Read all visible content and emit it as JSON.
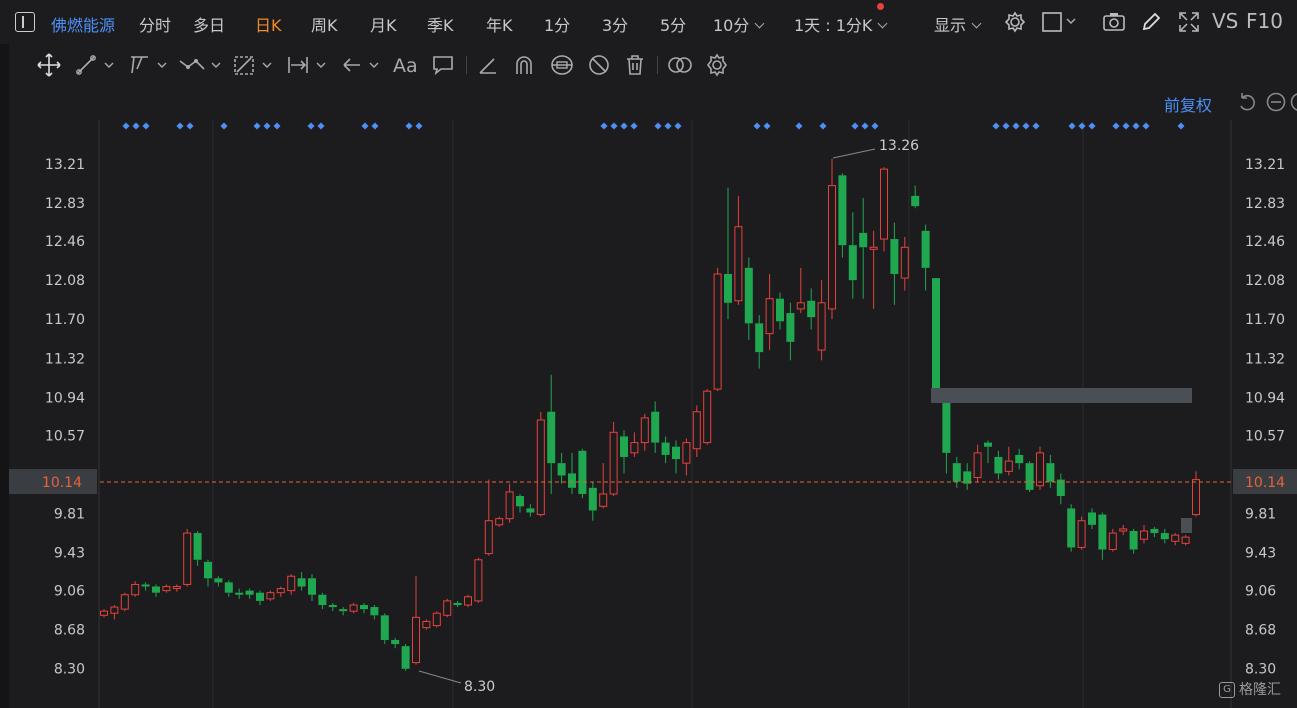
{
  "topbar": {
    "stock_name": "佛燃能源",
    "periods": [
      "分时",
      "多日",
      "日K",
      "周K",
      "月K",
      "季K",
      "年K",
      "1分",
      "3分",
      "5分",
      "10分"
    ],
    "active_period": "日K",
    "range_label": "1天 : 1分K",
    "display_label": "显示",
    "vs_label": "VS",
    "f10_label": "F10"
  },
  "chart": {
    "adjust_label": "前复权",
    "price_labels": [
      "13.21",
      "12.83",
      "12.46",
      "12.08",
      "11.70",
      "11.32",
      "10.94",
      "10.57",
      "10.14",
      "9.81",
      "9.43",
      "9.06",
      "8.68",
      "8.30"
    ],
    "current_price": "10.14",
    "high_marker": "13.26",
    "low_marker": "8.30"
  },
  "colors": {
    "up": "#e8413b",
    "down": "#1fa84f",
    "accent": "#4d8ff5",
    "active": "#f08a2a",
    "dashed_line": "#e8623a"
  },
  "candles": [
    [
      8.82,
      8.86,
      8.8,
      8.88
    ],
    [
      8.84,
      8.9,
      8.78,
      8.92
    ],
    [
      8.88,
      9.02,
      8.86,
      9.04
    ],
    [
      9.02,
      9.12,
      9.0,
      9.15
    ],
    [
      9.12,
      9.1,
      9.06,
      9.14
    ],
    [
      9.1,
      9.04,
      9.0,
      9.12
    ],
    [
      9.06,
      9.1,
      9.04,
      9.12
    ],
    [
      9.08,
      9.1,
      9.05,
      9.12
    ],
    [
      9.12,
      9.62,
      9.1,
      9.66
    ],
    [
      9.62,
      9.36,
      9.3,
      9.64
    ],
    [
      9.34,
      9.18,
      9.1,
      9.36
    ],
    [
      9.18,
      9.14,
      9.1,
      9.2
    ],
    [
      9.14,
      9.04,
      9.0,
      9.16
    ],
    [
      9.04,
      9.02,
      8.98,
      9.08
    ],
    [
      9.06,
      9.02,
      8.98,
      9.08
    ],
    [
      9.04,
      8.96,
      8.92,
      9.06
    ],
    [
      8.98,
      9.04,
      8.96,
      9.06
    ],
    [
      9.04,
      9.08,
      9.0,
      9.1
    ],
    [
      9.06,
      9.2,
      9.02,
      9.22
    ],
    [
      9.18,
      9.1,
      9.06,
      9.24
    ],
    [
      9.18,
      9.02,
      8.96,
      9.22
    ],
    [
      9.02,
      8.92,
      8.88,
      9.04
    ],
    [
      8.92,
      8.9,
      8.86,
      8.94
    ],
    [
      8.88,
      8.86,
      8.82,
      8.9
    ],
    [
      8.86,
      8.92,
      8.84,
      8.94
    ],
    [
      8.92,
      8.88,
      8.84,
      8.94
    ],
    [
      8.9,
      8.82,
      8.78,
      8.92
    ],
    [
      8.82,
      8.58,
      8.54,
      8.84
    ],
    [
      8.58,
      8.54,
      8.5,
      8.6
    ],
    [
      8.52,
      8.3,
      8.28,
      8.54
    ],
    [
      8.36,
      8.8,
      8.34,
      9.2
    ],
    [
      8.7,
      8.76,
      8.68,
      8.78
    ],
    [
      8.72,
      8.84,
      8.7,
      8.86
    ],
    [
      8.82,
      8.96,
      8.8,
      8.98
    ],
    [
      8.94,
      8.92,
      8.9,
      8.96
    ],
    [
      8.92,
      9.0,
      8.9,
      9.02
    ],
    [
      8.96,
      9.36,
      8.94,
      9.38
    ],
    [
      9.42,
      9.74,
      9.4,
      10.14
    ],
    [
      9.7,
      9.76,
      9.68,
      9.78
    ],
    [
      9.76,
      10.02,
      9.72,
      10.1
    ],
    [
      9.98,
      9.88,
      9.82,
      10.0
    ],
    [
      9.86,
      9.82,
      9.78,
      9.9
    ],
    [
      9.8,
      10.72,
      9.78,
      10.8
    ],
    [
      10.8,
      10.3,
      10.0,
      11.16
    ],
    [
      10.3,
      10.18,
      10.1,
      10.4
    ],
    [
      10.2,
      10.06,
      10.0,
      10.4
    ],
    [
      10.42,
      10.0,
      9.96,
      10.44
    ],
    [
      10.06,
      9.84,
      9.74,
      10.12
    ],
    [
      9.88,
      10.0,
      9.86,
      10.3
    ],
    [
      10.0,
      10.6,
      9.98,
      10.7
    ],
    [
      10.56,
      10.36,
      10.2,
      10.62
    ],
    [
      10.4,
      10.5,
      10.36,
      10.6
    ],
    [
      10.5,
      10.74,
      10.42,
      10.78
    ],
    [
      10.8,
      10.5,
      10.4,
      10.9
    ],
    [
      10.5,
      10.38,
      10.3,
      10.56
    ],
    [
      10.46,
      10.34,
      10.2,
      10.52
    ],
    [
      10.3,
      10.5,
      10.18,
      10.54
    ],
    [
      10.44,
      10.8,
      10.36,
      10.86
    ],
    [
      10.5,
      11.0,
      10.48,
      11.02
    ],
    [
      11.02,
      12.14,
      11.0,
      12.2
    ],
    [
      12.14,
      11.86,
      11.7,
      12.98
    ],
    [
      11.88,
      12.6,
      11.84,
      12.9
    ],
    [
      12.2,
      11.66,
      11.5,
      12.3
    ],
    [
      11.66,
      11.38,
      11.22,
      11.74
    ],
    [
      11.56,
      11.9,
      11.4,
      12.14
    ],
    [
      11.9,
      11.68,
      11.6,
      11.96
    ],
    [
      11.76,
      11.48,
      11.3,
      11.86
    ],
    [
      11.8,
      11.86,
      11.76,
      12.2
    ],
    [
      11.88,
      11.72,
      11.6,
      12.0
    ],
    [
      11.4,
      11.86,
      11.3,
      12.08
    ],
    [
      11.8,
      13.0,
      11.7,
      13.26
    ],
    [
      13.1,
      12.42,
      12.3,
      13.12
    ],
    [
      12.42,
      12.08,
      11.9,
      12.74
    ],
    [
      12.54,
      12.4,
      11.9,
      12.88
    ],
    [
      12.38,
      12.4,
      11.8,
      12.56
    ],
    [
      12.48,
      13.16,
      12.36,
      13.18
    ],
    [
      12.48,
      12.14,
      11.84,
      12.64
    ],
    [
      12.1,
      12.4,
      11.98,
      12.5
    ],
    [
      12.9,
      12.8,
      12.78,
      13.0
    ],
    [
      12.56,
      12.2,
      11.98,
      12.62
    ],
    [
      12.1,
      11.02,
      11.0,
      12.1
    ],
    [
      10.9,
      10.4,
      10.2,
      10.96
    ],
    [
      10.3,
      10.12,
      10.06,
      10.36
    ],
    [
      10.22,
      10.1,
      10.04,
      10.3
    ],
    [
      10.16,
      10.4,
      10.12,
      10.48
    ],
    [
      10.5,
      10.46,
      10.3,
      10.52
    ],
    [
      10.36,
      10.2,
      10.14,
      10.42
    ],
    [
      10.22,
      10.32,
      10.18,
      10.46
    ],
    [
      10.38,
      10.3,
      10.24,
      10.44
    ],
    [
      10.3,
      10.04,
      10.02,
      10.32
    ],
    [
      10.08,
      10.4,
      10.04,
      10.46
    ],
    [
      10.3,
      10.12,
      10.06,
      10.38
    ],
    [
      10.14,
      9.98,
      9.9,
      10.2
    ],
    [
      9.86,
      9.48,
      9.44,
      9.9
    ],
    [
      9.48,
      9.74,
      9.46,
      9.78
    ],
    [
      9.82,
      9.7,
      9.66,
      9.86
    ],
    [
      9.8,
      9.46,
      9.36,
      9.82
    ],
    [
      9.46,
      9.62,
      9.44,
      9.66
    ],
    [
      9.64,
      9.66,
      9.6,
      9.7
    ],
    [
      9.64,
      9.46,
      9.42,
      9.66
    ],
    [
      9.56,
      9.64,
      9.52,
      9.7
    ],
    [
      9.66,
      9.62,
      9.58,
      9.68
    ],
    [
      9.62,
      9.56,
      9.52,
      9.66
    ],
    [
      9.54,
      9.6,
      9.5,
      9.62
    ],
    [
      9.52,
      9.58,
      9.5,
      9.6
    ],
    [
      9.8,
      10.14,
      9.78,
      10.22
    ]
  ]
}
